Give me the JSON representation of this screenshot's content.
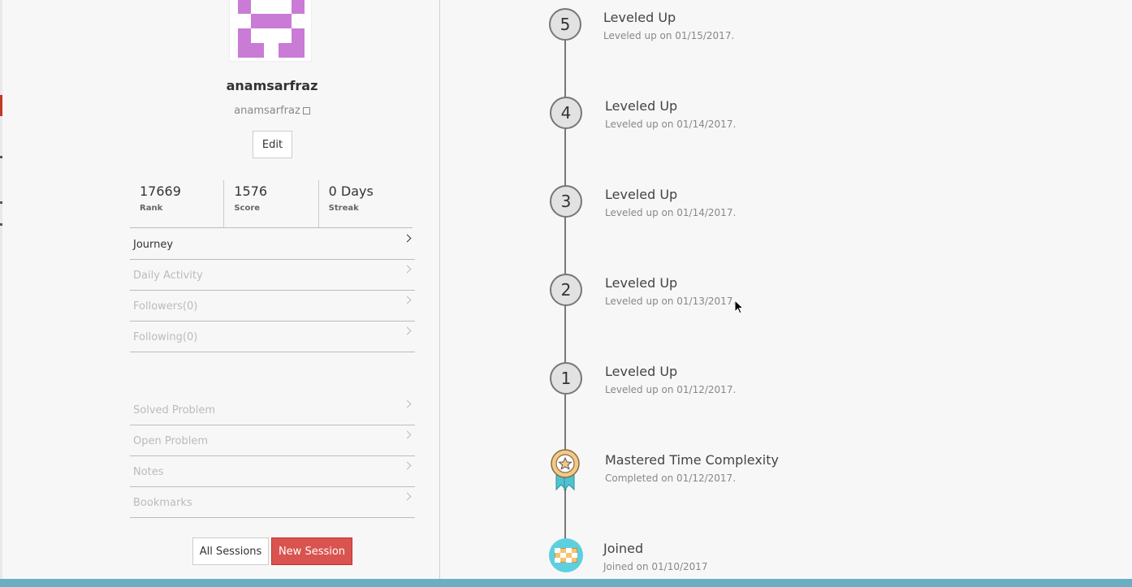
{
  "profile": {
    "display_name": "anamsarfraz",
    "handle": "anamsarfraz",
    "edit_label": "Edit"
  },
  "stats": [
    {
      "value": "17669",
      "label": "Rank"
    },
    {
      "value": "1576",
      "label": "Score"
    },
    {
      "value": "0 Days",
      "label": "Streak"
    }
  ],
  "menu_primary": [
    {
      "label": "Journey"
    },
    {
      "label": "Daily Activity"
    },
    {
      "label": "Followers(0)"
    },
    {
      "label": "Following(0)"
    }
  ],
  "menu_secondary": [
    {
      "label": "Solved Problem"
    },
    {
      "label": "Open Problem"
    },
    {
      "label": "Notes"
    },
    {
      "label": "Bookmarks"
    }
  ],
  "buttons": {
    "all_sessions": "All Sessions",
    "new_session": "New Session"
  },
  "timeline": [
    {
      "badge": "5",
      "title": "Leveled Up",
      "subtitle": "Leveled up on 01/15/2017."
    },
    {
      "badge": "4",
      "title": "Leveled Up",
      "subtitle": "Leveled up on 01/14/2017."
    },
    {
      "badge": "3",
      "title": "Leveled Up",
      "subtitle": "Leveled up on 01/14/2017."
    },
    {
      "badge": "2",
      "title": "Leveled Up",
      "subtitle": "Leveled up on 01/13/2017."
    },
    {
      "badge": "1",
      "title": "Leveled Up",
      "subtitle": "Leveled up on 01/12/2017."
    },
    {
      "title": "Mastered Time Complexity",
      "subtitle": "Completed on 01/12/2017."
    },
    {
      "title": "Joined",
      "subtitle": "Joined on 01/10/2017"
    }
  ],
  "colors": {
    "accent_red": "#d9534f",
    "bottom_bar": "#6aaec4",
    "avatar": "#c97bd6",
    "joined_icon": "#5ecfde"
  }
}
